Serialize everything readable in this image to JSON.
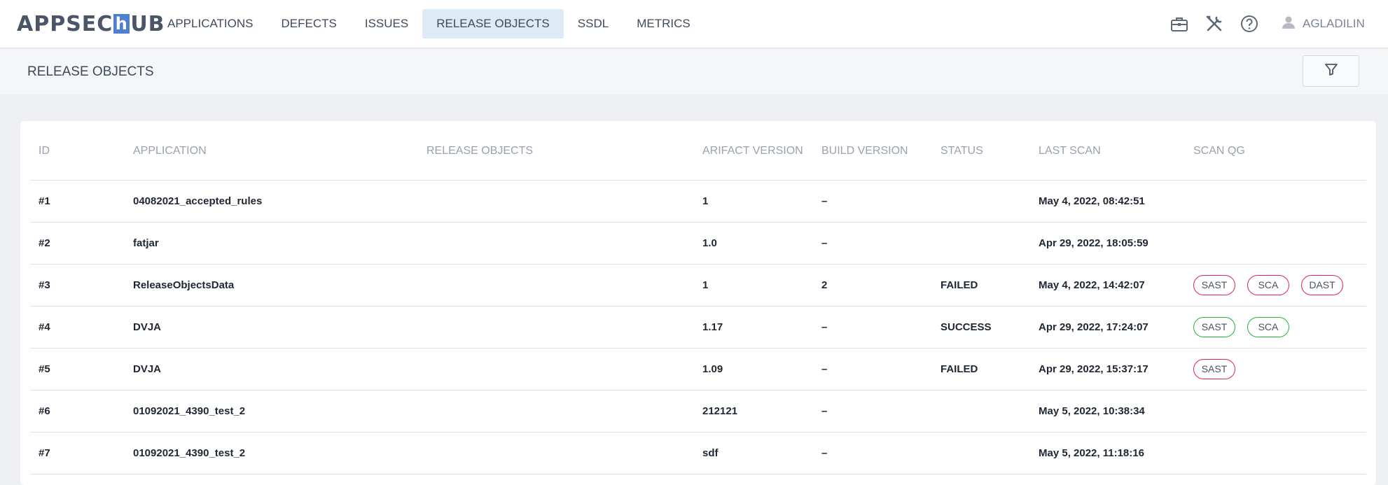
{
  "logo": {
    "pre": "APPSEC",
    "h": "h",
    "post": "UB"
  },
  "nav": [
    {
      "label": "APPLICATIONS",
      "active": false
    },
    {
      "label": "DEFECTS",
      "active": false
    },
    {
      "label": "ISSUES",
      "active": false
    },
    {
      "label": "RELEASE OBJECTS",
      "active": true
    },
    {
      "label": "SSDL",
      "active": false
    },
    {
      "label": "METRICS",
      "active": false
    }
  ],
  "user": {
    "name": "AGLADILIN"
  },
  "icons": {
    "toolbox": "briefcase-icon",
    "tools": "tools-icon",
    "help": "help-icon",
    "user": "user-icon",
    "filter": "filter-icon"
  },
  "page": {
    "title": "RELEASE OBJECTS"
  },
  "table": {
    "headers": [
      "ID",
      "APPLICATION",
      "RELEASE OBJECTS",
      "ARIFACT VERSION",
      "BUILD VERSION",
      "STATUS",
      "LAST SCAN",
      "SCAN QG"
    ],
    "rows": [
      {
        "id": "#1",
        "application": "04082021_accepted_rules",
        "release_objects": "",
        "artifact_version": "1",
        "build_version": "–",
        "status": "",
        "last_scan": "May 4, 2022, 08:42:51",
        "scan_qg": []
      },
      {
        "id": "#2",
        "application": "fatjar",
        "release_objects": "",
        "artifact_version": "1.0",
        "build_version": "–",
        "status": "",
        "last_scan": "Apr 29, 2022, 18:05:59",
        "scan_qg": []
      },
      {
        "id": "#3",
        "application": "ReleaseObjectsData",
        "release_objects": "",
        "artifact_version": "1",
        "build_version": "2",
        "status": "FAILED",
        "last_scan": "May 4, 2022, 14:42:07",
        "scan_qg": [
          {
            "label": "SAST",
            "state": "failed"
          },
          {
            "label": "SCA",
            "state": "failed"
          },
          {
            "label": "DAST",
            "state": "failed"
          }
        ]
      },
      {
        "id": "#4",
        "application": "DVJA",
        "release_objects": "",
        "artifact_version": "1.17",
        "build_version": "–",
        "status": "SUCCESS",
        "last_scan": "Apr 29, 2022, 17:24:07",
        "scan_qg": [
          {
            "label": "SAST",
            "state": "passed"
          },
          {
            "label": "SCA",
            "state": "passed"
          }
        ]
      },
      {
        "id": "#5",
        "application": "DVJA",
        "release_objects": "",
        "artifact_version": "1.09",
        "build_version": "–",
        "status": "FAILED",
        "last_scan": "Apr 29, 2022, 15:37:17",
        "scan_qg": [
          {
            "label": "SAST",
            "state": "failed"
          }
        ]
      },
      {
        "id": "#6",
        "application": "01092021_4390_test_2",
        "release_objects": "",
        "artifact_version": "212121",
        "build_version": "–",
        "status": "",
        "last_scan": "May 5, 2022, 10:38:34",
        "scan_qg": []
      },
      {
        "id": "#7",
        "application": "01092021_4390_test_2",
        "release_objects": "",
        "artifact_version": "sdf",
        "build_version": "–",
        "status": "",
        "last_scan": "May 5, 2022, 11:18:16",
        "scan_qg": []
      }
    ]
  },
  "colors": {
    "qg_failed": "#e0294d",
    "qg_passed": "#27b53e",
    "nav_active_bg": "#deebf6",
    "logo_accent": "#4f7fcf"
  }
}
